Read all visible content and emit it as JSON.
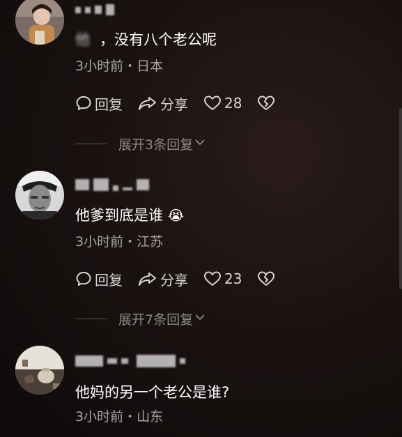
{
  "comments": [
    {
      "text": "，没有八个老公呢",
      "text_prefix_obscured": "他",
      "meta": "3小时前・日本",
      "reply_label": "回复",
      "share_label": "分享",
      "likes": "28",
      "expand_label": "展开3条回复"
    },
    {
      "text": "他爹到底是谁",
      "emoji": "😭",
      "meta": "3小时前・江苏",
      "reply_label": "回复",
      "share_label": "分享",
      "likes": "23",
      "expand_label": "展开7条回复"
    },
    {
      "text": "他妈的另一个老公是谁?",
      "meta": "3小时前・山东"
    }
  ],
  "icons": {
    "reply": "comment-bubble-icon",
    "share": "share-arrow-icon",
    "like": "heart-icon",
    "dislike": "broken-heart-icon",
    "expand": "chevron-down-icon"
  }
}
